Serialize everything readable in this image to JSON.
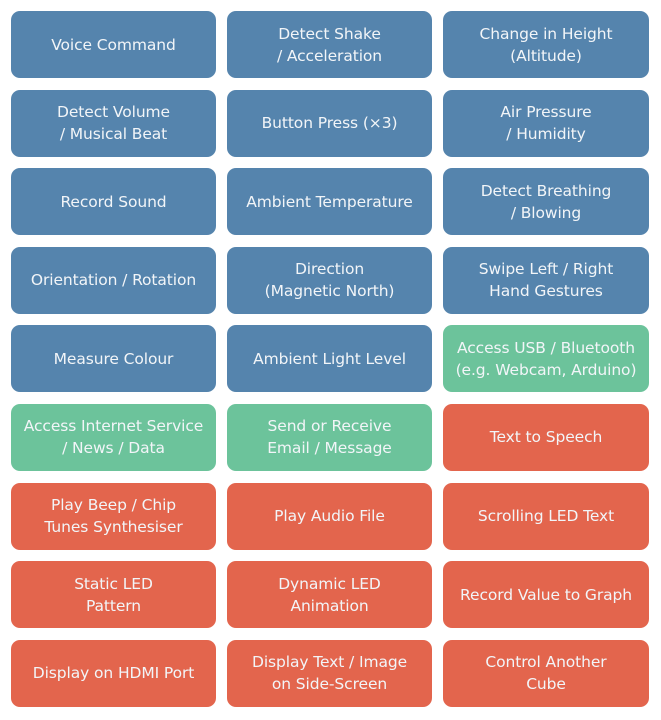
{
  "colors": {
    "input": "#5584ad",
    "connect": "#6cc39b",
    "output": "#e3654d",
    "text": "#f2f5f8"
  },
  "tiles": [
    {
      "label": "Voice Command",
      "category": "input"
    },
    {
      "label": "Detect Shake\n/ Acceleration",
      "category": "input"
    },
    {
      "label": "Change in Height\n(Altitude)",
      "category": "input"
    },
    {
      "label": "Detect Volume\n/ Musical Beat",
      "category": "input"
    },
    {
      "label": "Button Press (×3)",
      "category": "input"
    },
    {
      "label": "Air Pressure\n/ Humidity",
      "category": "input"
    },
    {
      "label": "Record Sound",
      "category": "input"
    },
    {
      "label": "Ambient Temperature",
      "category": "input"
    },
    {
      "label": "Detect Breathing\n/ Blowing",
      "category": "input"
    },
    {
      "label": "Orientation / Rotation",
      "category": "input"
    },
    {
      "label": "Direction\n(Magnetic North)",
      "category": "input"
    },
    {
      "label": "Swipe Left / Right\nHand Gestures",
      "category": "input"
    },
    {
      "label": "Measure Colour",
      "category": "input"
    },
    {
      "label": "Ambient Light Level",
      "category": "input"
    },
    {
      "label": "Access USB / Bluetooth\n(e.g. Webcam, Arduino)",
      "category": "connect"
    },
    {
      "label": "Access Internet Service\n/ News / Data",
      "category": "connect"
    },
    {
      "label": "Send or Receive\nEmail / Message",
      "category": "connect"
    },
    {
      "label": "Text to Speech",
      "category": "output"
    },
    {
      "label": "Play Beep / Chip\nTunes Synthesiser",
      "category": "output"
    },
    {
      "label": "Play Audio File",
      "category": "output"
    },
    {
      "label": "Scrolling LED Text",
      "category": "output"
    },
    {
      "label": "Static LED\nPattern",
      "category": "output"
    },
    {
      "label": "Dynamic LED\nAnimation",
      "category": "output"
    },
    {
      "label": "Record Value to Graph",
      "category": "output"
    },
    {
      "label": "Display on HDMI Port",
      "category": "output"
    },
    {
      "label": "Display Text / Image\non Side-Screen",
      "category": "output"
    },
    {
      "label": "Control Another\nCube",
      "category": "output"
    }
  ]
}
